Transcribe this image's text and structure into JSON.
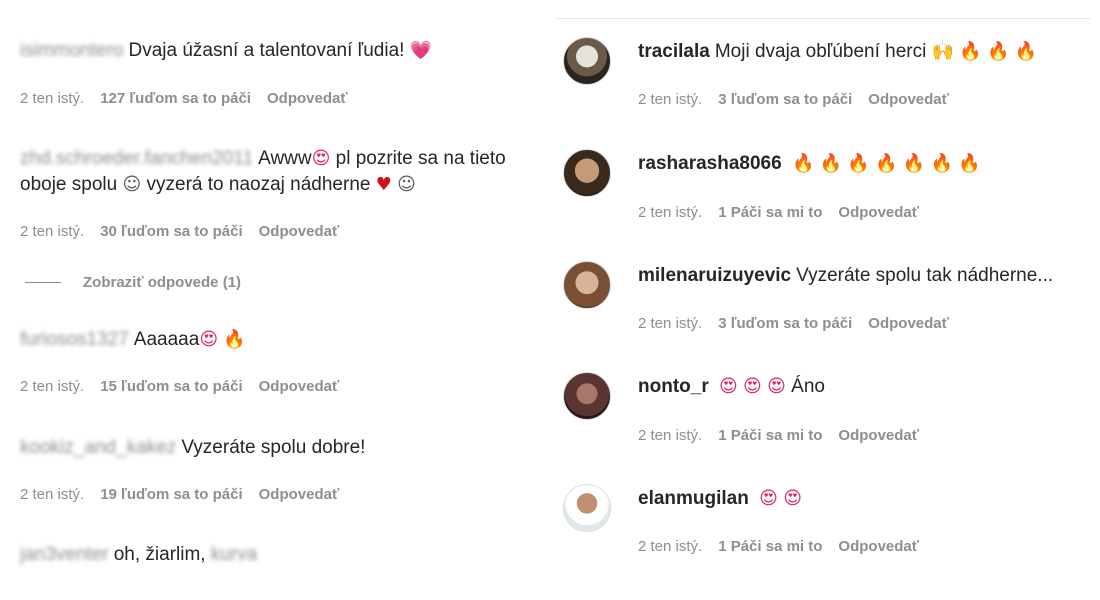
{
  "left_comments": [
    {
      "username": "isimmontero",
      "text": "Dvaja úžasní a talentovaní ľudia!",
      "time": "2 ten istý.",
      "likes": "127 ľuďom sa to páči",
      "reply": "Odpovedať"
    },
    {
      "username": "zhd.schroeder.fanchen2011",
      "text_a": "Awww",
      "text_b": "pl pozrite sa na tieto",
      "text_c": "oboje spolu",
      "text_d": "vyzerá to naozaj nádherne",
      "time": "2 ten istý.",
      "likes": "30 ľuďom sa to páči",
      "reply": "Odpovedať",
      "view_replies": "Zobraziť odpovede (1)"
    },
    {
      "username": "furiosos1327",
      "text": "Aaaaaa",
      "time": "2 ten istý.",
      "likes": "15 ľuďom sa to páči",
      "reply": "Odpovedať"
    },
    {
      "username": "kookiz_and_kakez",
      "text": "Vyzeráte spolu dobre!",
      "time": "2 ten istý.",
      "likes": "19 ľuďom sa to páči",
      "reply": "Odpovedať"
    },
    {
      "username": "jan3venter",
      "text": "oh, žiarlim,",
      "trail": "kurva"
    }
  ],
  "right_comments": [
    {
      "username": "tracilala",
      "text": "Moji dvaja obľúbení herci",
      "time": "2 ten istý.",
      "likes": "3 ľuďom sa to páči",
      "reply": "Odpovedať"
    },
    {
      "username": "rasharasha8066",
      "text": "",
      "time": "2 ten istý.",
      "likes": "1 Páči sa mi to",
      "reply": "Odpovedať"
    },
    {
      "username": "milenaruizuyevic",
      "text": "Vyzeráte spolu tak nádherne...",
      "time": "2 ten istý.",
      "likes": "3 ľuďom sa to páči",
      "reply": "Odpovedať"
    },
    {
      "username": "nonto_r",
      "text": "Áno",
      "time": "2 ten istý.",
      "likes": "1 Páči sa mi to",
      "reply": "Odpovedať"
    },
    {
      "username": "elanmugilan",
      "text": "",
      "time": "2 ten istý.",
      "likes": "1 Páči sa mi to",
      "reply": "Odpovedať"
    }
  ],
  "icons": {
    "fire": "🔥",
    "heart_eyes": "😍",
    "heart": "♥",
    "pink_heart": "💗",
    "smile": "☺",
    "raised_hands": "🙌"
  },
  "colors": {
    "text": "#262626",
    "meta": "#8e8e8e",
    "fire": "#f57c00"
  }
}
